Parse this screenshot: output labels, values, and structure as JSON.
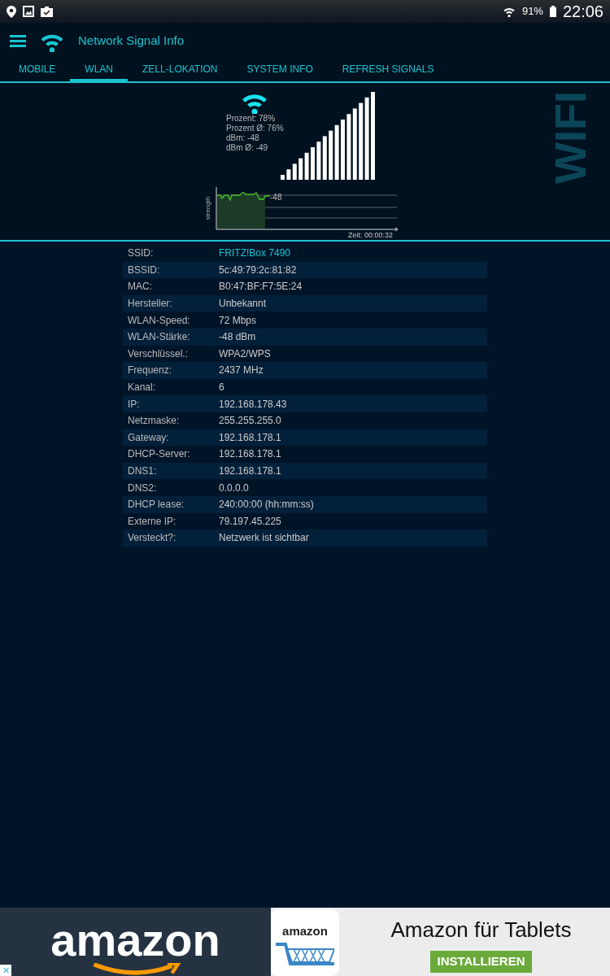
{
  "status_bar": {
    "battery": "91%",
    "time": "22:06"
  },
  "app_bar": {
    "title": "Network Signal Info"
  },
  "tabs": [
    {
      "label": "MOBILE",
      "selected": false
    },
    {
      "label": "WLAN",
      "selected": true
    },
    {
      "label": "ZELL-LOKATION",
      "selected": false
    },
    {
      "label": "SYSTEM INFO",
      "selected": false
    },
    {
      "label": "REFRESH SIGNALS",
      "selected": false
    }
  ],
  "signal": {
    "stats": [
      "Prozent: 78%",
      "Prozent Ø: 76%",
      "dBm: -48",
      "dBm Ø: -49"
    ],
    "side_label": "WIFI",
    "graph": {
      "ylabel": "strength",
      "value_label": "-48",
      "time_label": "Zeit: 00:00:32"
    }
  },
  "details": [
    {
      "label": "SSID:",
      "value": "FRITZ!Box 7490",
      "highlight": true
    },
    {
      "label": "BSSID:",
      "value": "5c:49:79:2c:81:82",
      "highlight": false
    },
    {
      "label": "MAC:",
      "value": "B0:47:BF:F7:5E:24",
      "highlight": false
    },
    {
      "label": "Hersteller:",
      "value": "Unbekannt",
      "highlight": false
    },
    {
      "label": "WLAN-Speed:",
      "value": "72 Mbps",
      "highlight": false
    },
    {
      "label": "WLAN-Stärke:",
      "value": "-48 dBm",
      "highlight": false
    },
    {
      "label": "Verschlüssel.:",
      "value": "WPA2/WPS",
      "highlight": false
    },
    {
      "label": "Frequenz:",
      "value": "2437 MHz",
      "highlight": false
    },
    {
      "label": "Kanal:",
      "value": "6",
      "highlight": false
    },
    {
      "label": "IP:",
      "value": "192.168.178.43",
      "highlight": false
    },
    {
      "label": "Netzmaske:",
      "value": "255.255.255.0",
      "highlight": false
    },
    {
      "label": "Gateway:",
      "value": "192.168.178.1",
      "highlight": false
    },
    {
      "label": "DHCP-Server:",
      "value": "192.168.178.1",
      "highlight": false
    },
    {
      "label": "DNS1:",
      "value": "192.168.178.1",
      "highlight": false
    },
    {
      "label": "DNS2:",
      "value": "0.0.0.0",
      "highlight": false
    },
    {
      "label": "DHCP lease:",
      "value": "240:00:00 (hh:mm:ss)",
      "highlight": false
    },
    {
      "label": "Externe IP:",
      "value": "79.197.45.225",
      "highlight": false
    },
    {
      "label": "Versteckt?:",
      "value": "Netzwerk ist sichtbar",
      "highlight": false
    }
  ],
  "ad": {
    "close": "✕",
    "brand": "amazon",
    "app_icon_brand": "amazon",
    "title": "Amazon für Tablets",
    "button": "INSTALLIEREN"
  }
}
